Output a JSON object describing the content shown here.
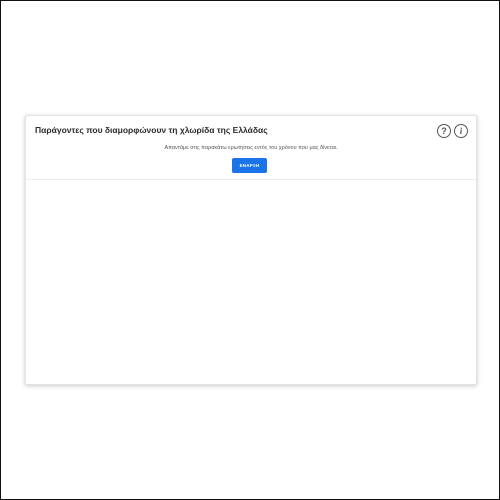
{
  "card": {
    "title": "Παράγοντες που διαμορφώνουν τη χλωρίδα της Ελλάδας",
    "subtitle": "Απαντάμε στις παρακάτω ερωτήσεις εντός του χρόνου που μας δίνεται.",
    "start_label": "ΕΝΑΡΞΗ",
    "help_icon_glyph": "?",
    "info_icon_glyph": "i"
  },
  "colors": {
    "accent": "#1a73e8",
    "title_text": "#2a2a2a",
    "icon": "#555555"
  },
  "icons": {
    "help": "help-circle-icon",
    "info": "info-circle-icon"
  }
}
